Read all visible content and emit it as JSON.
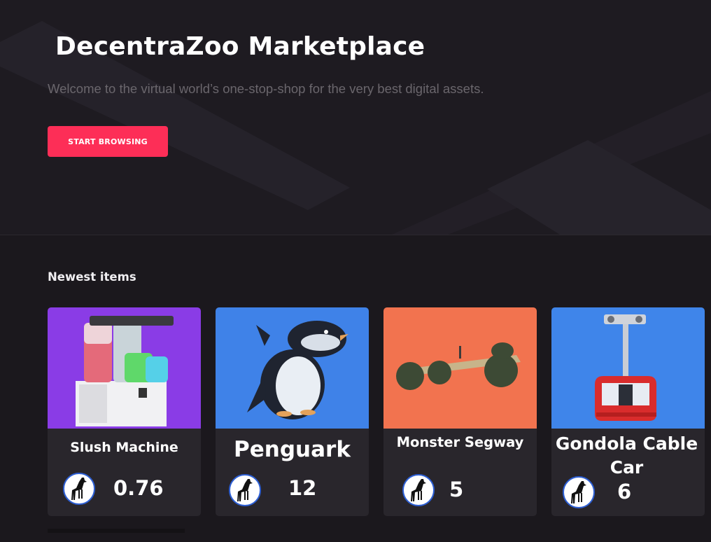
{
  "hero": {
    "title": "DecentraZoo Marketplace",
    "subtitle": "Welcome to the virtual world’s one-stop-shop for the very best digital assets.",
    "cta_label": "START BROWSING"
  },
  "newest": {
    "heading": "Newest items",
    "items": [
      {
        "name": "Slush Machine",
        "price": "0.76",
        "image": "slush-machine-image",
        "bg": "#8a3ce6"
      },
      {
        "name": "Penguark",
        "price": "12",
        "image": "penguark-image",
        "bg": "#3f82e8"
      },
      {
        "name": "Monster Segway",
        "price": "5",
        "image": "monster-segway-image",
        "bg": "#f2734f"
      },
      {
        "name": "Gondola Cable Car",
        "price": "6",
        "image": "gondola-cable-car-image",
        "bg": "#3f85ea"
      }
    ]
  },
  "currency_icon": "giraffe-icon",
  "colors": {
    "accent": "#fd2e57",
    "background": "#1b181d",
    "card": "#29262c"
  }
}
